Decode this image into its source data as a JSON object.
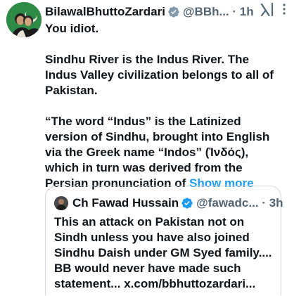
{
  "tweet": {
    "display_name": "BilawalBhuttoZardari",
    "handle": "@BBh...",
    "separator": " · ",
    "time": "1h",
    "paragraphs": [
      "You idiot.",
      "Sindhu River is the Indus River. The Indus Valley civilization belongs to all of Pakistan.",
      "“The word “Indus” is the Latinized version of Sindhu, brought into English via the Greek name “Indos” (Ἰνδός), which in turn was derived from the Persian pronunciation of"
    ],
    "show_more": "Show more"
  },
  "quoted_tweet": {
    "display_name": "Ch Fawad Hussain",
    "handle": "@fawadc...",
    "separator": " · ",
    "time": "3h",
    "text": "This an attack on Pakistan not on Sindh unless you have also joined Sindhu Daish under GM Syed family.... BB would never have made such statement... x.com/bbhuttozardari..."
  },
  "icons": {
    "verified": "verified-badge-icon",
    "grok": "grok-icon",
    "more": "more-icon"
  },
  "colors": {
    "text": "#0f1419",
    "secondary": "#536471",
    "link": "#1d9bf0",
    "border": "#cfd9de"
  }
}
